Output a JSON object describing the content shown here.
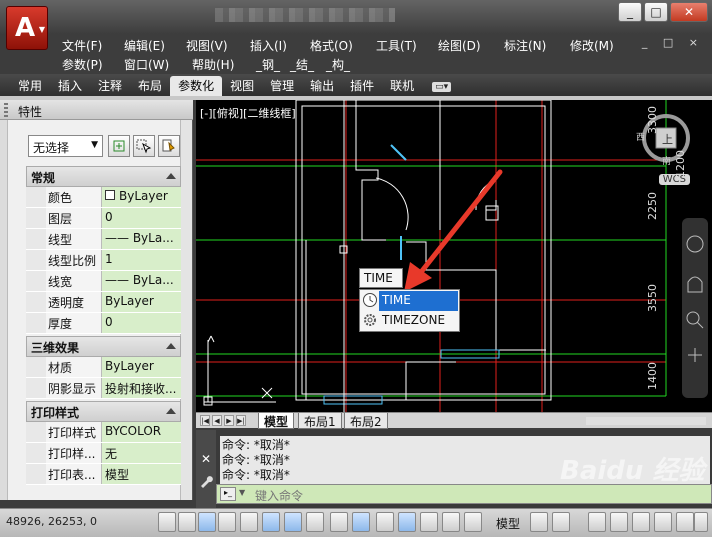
{
  "title_bar": {
    "window_controls": {
      "minimize": "_",
      "restore": "□",
      "close": "✕"
    },
    "app_menu_icon": "autocad-logo-icon"
  },
  "menu": {
    "row1": [
      "文件(F)",
      "编辑(E)",
      "视图(V)",
      "插入(I)",
      "格式(O)",
      "工具(T)",
      "绘图(D)",
      "标注(N)",
      "修改(M)"
    ],
    "row2": [
      "参数(P)",
      "窗口(W)",
      "帮助(H)",
      "_钢_",
      "_结_",
      "_构_"
    ],
    "mdi_controls": "_ □ ×"
  },
  "ribbon": {
    "tabs": [
      "常用",
      "插入",
      "注释",
      "布局",
      "参数化",
      "视图",
      "管理",
      "输出",
      "插件",
      "联机"
    ],
    "active_tab": "参数化",
    "overflow_icon": "ribbon-overflow-icon"
  },
  "properties": {
    "title": "特性",
    "selection": "无选择",
    "sections": [
      {
        "name": "常规",
        "rows": [
          {
            "name": "颜色",
            "value": "ByLayer",
            "swatch": true
          },
          {
            "name": "图层",
            "value": "0"
          },
          {
            "name": "线型",
            "value": "—— ByLa..."
          },
          {
            "name": "线型比例",
            "value": "1"
          },
          {
            "name": "线宽",
            "value": "—— ByLa..."
          },
          {
            "name": "透明度",
            "value": "ByLayer"
          },
          {
            "name": "厚度",
            "value": "0"
          }
        ]
      },
      {
        "name": "三维效果",
        "rows": [
          {
            "name": "材质",
            "value": "ByLayer"
          },
          {
            "name": "阴影显示",
            "value": "投射和接收..."
          }
        ]
      },
      {
        "name": "打印样式",
        "rows": [
          {
            "name": "打印样式",
            "value": "BYCOLOR"
          },
          {
            "name": "打印样...",
            "value": "无"
          },
          {
            "name": "打印表...",
            "value": "模型"
          }
        ]
      }
    ]
  },
  "drawing": {
    "view_label": "[-][俯视][二维线框]",
    "viewcube": {
      "top": "上",
      "west": "西",
      "south": "南"
    },
    "wcs": "WCS",
    "dimensions": [
      "3300",
      "1200",
      "2250",
      "3550",
      "1400"
    ],
    "tooltip": "TIME",
    "autocomplete": [
      {
        "label": "TIME",
        "icon": "clock-icon",
        "selected": true
      },
      {
        "label": "TIMEZONE",
        "icon": "gear-icon",
        "selected": false
      }
    ]
  },
  "layout_tabs": [
    "模型",
    "布局1",
    "布局2"
  ],
  "command": {
    "history": [
      "命令: *取消*",
      "命令: *取消*",
      "命令: *取消*"
    ],
    "placeholder": "键入命令"
  },
  "status": {
    "coordinates": "48926, 26253, 0",
    "model": "模型"
  },
  "watermark": "Baidu 经验"
}
